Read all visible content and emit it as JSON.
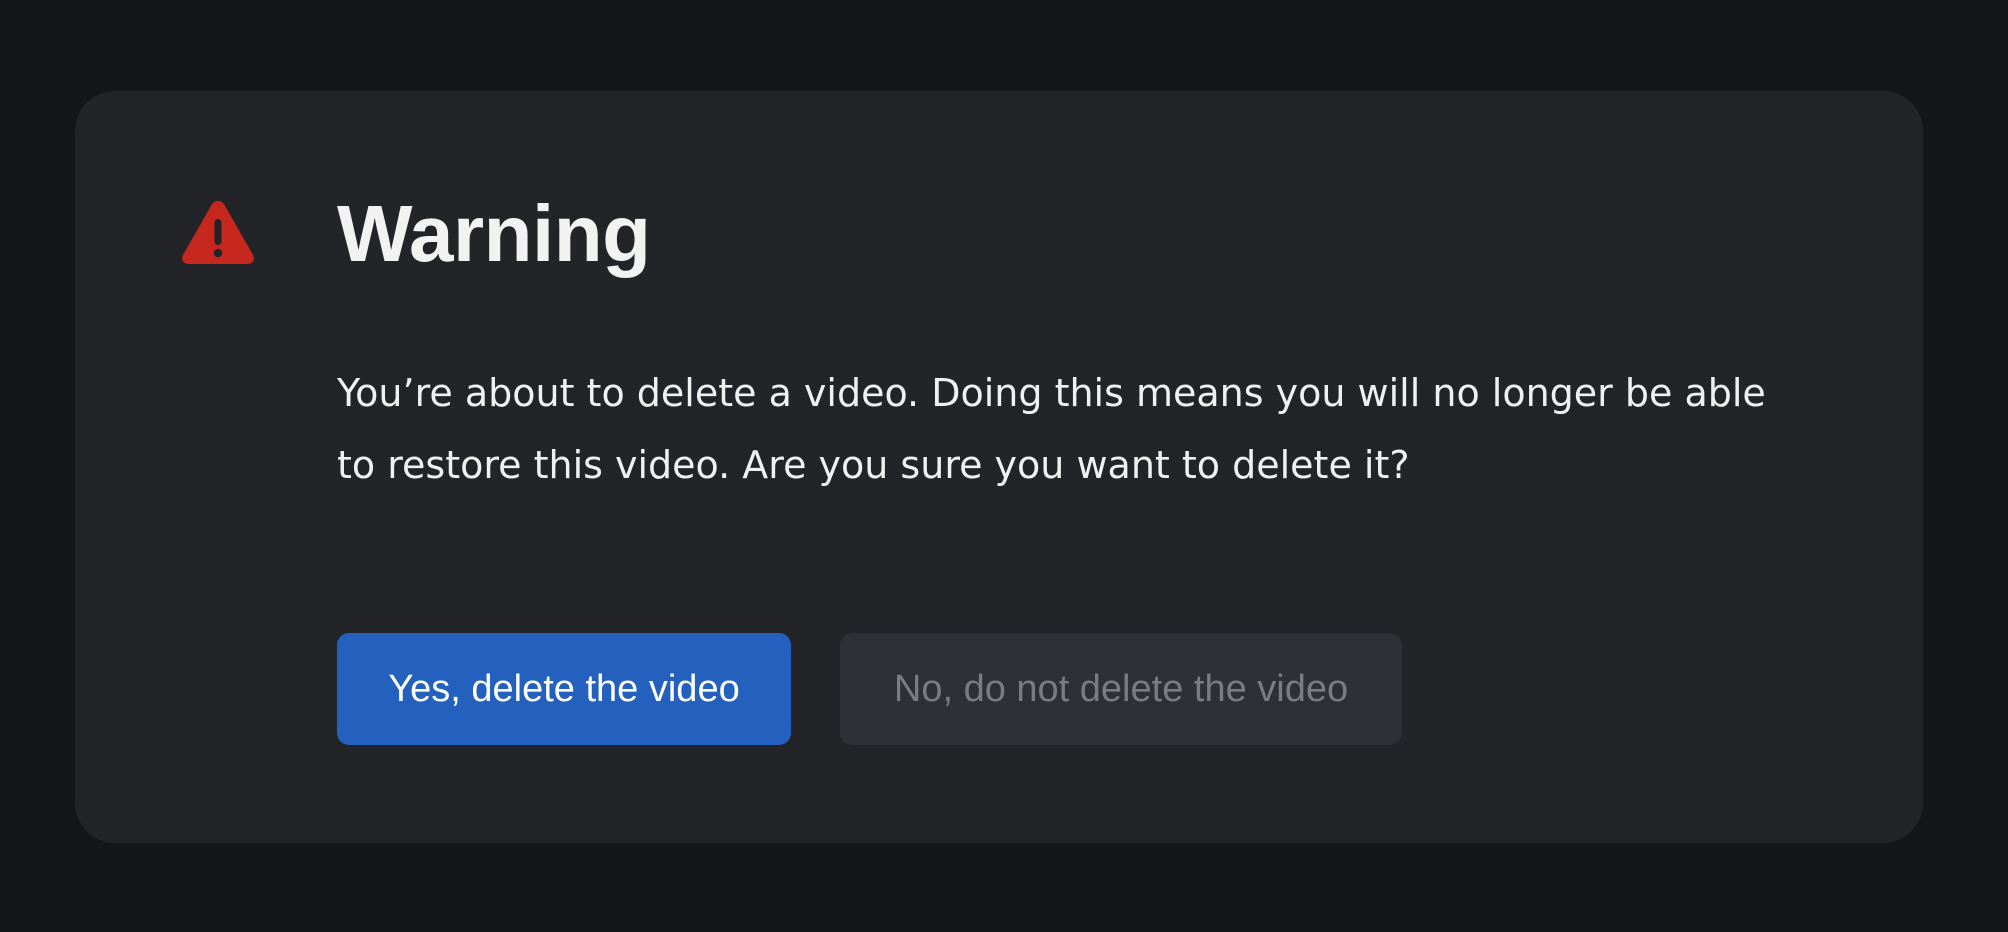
{
  "dialog": {
    "icon": "warning-triangle-icon",
    "title": "Warning",
    "message": "You’re about to delete a video. Doing this means you will no longer be able to restore this video. Are you sure you want to delete it?",
    "confirm_label": "Yes, delete the video",
    "cancel_label": "No, do not delete the video"
  },
  "colors": {
    "page_background": "#151618",
    "dialog_background": "#232427",
    "warning_red": "#c6281f",
    "primary_button": "#2461bf",
    "secondary_button": "#2e3035",
    "secondary_button_text": "#7a7c80"
  }
}
